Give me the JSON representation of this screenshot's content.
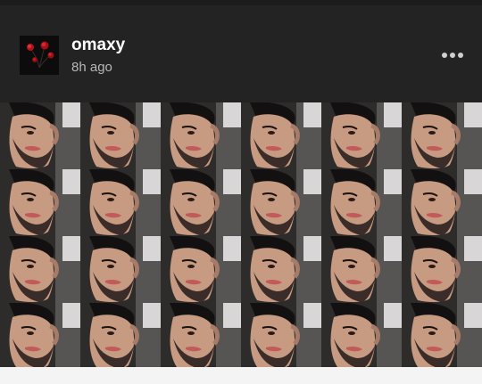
{
  "post": {
    "username": "omaxy",
    "time_ago": "8h ago",
    "avatar_icon": "roses-avatar-icon",
    "more_icon": "more-options-icon",
    "image": {
      "description_icon": "portrait-collage-image",
      "rows": 4,
      "columns": 6
    }
  },
  "colors": {
    "background": "#252525",
    "header": "#232323",
    "username": "#ffffff",
    "time": "#b8b8b8"
  }
}
